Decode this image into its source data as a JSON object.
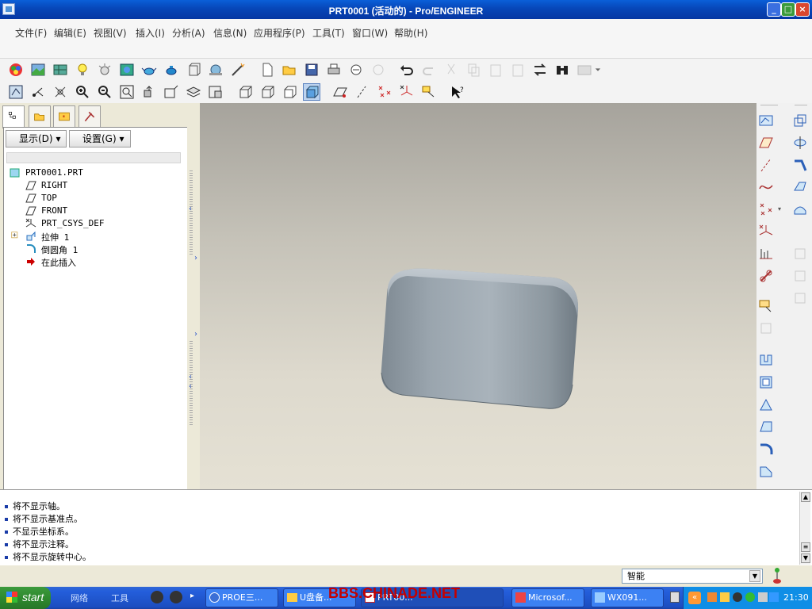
{
  "window": {
    "title": "PRT0001 (活动的) - Pro/ENGINEER"
  },
  "menu": [
    {
      "label": "文件(F)"
    },
    {
      "label": "编辑(E)"
    },
    {
      "label": "视图(V)"
    },
    {
      "label": "插入(I)"
    },
    {
      "label": "分析(A)"
    },
    {
      "label": "信息(N)"
    },
    {
      "label": "应用程序(P)"
    },
    {
      "label": "工具(T)"
    },
    {
      "label": "窗口(W)"
    },
    {
      "label": "帮助(H)"
    }
  ],
  "model_tree": {
    "show_dropdown": "显示(D)",
    "settings_dropdown": "设置(G)",
    "items": [
      {
        "label": "PRT0001.PRT",
        "icon": "part-icon"
      },
      {
        "label": "RIGHT",
        "icon": "datum-plane-icon"
      },
      {
        "label": "TOP",
        "icon": "datum-plane-icon"
      },
      {
        "label": "FRONT",
        "icon": "datum-plane-icon"
      },
      {
        "label": "PRT_CSYS_DEF",
        "icon": "csys-icon"
      },
      {
        "label": "拉伸 1",
        "icon": "extrude-icon"
      },
      {
        "label": "倒圆角 1",
        "icon": "round-icon"
      },
      {
        "label": "在此插入",
        "icon": "insert-here-arrow-icon"
      }
    ]
  },
  "messages": [
    "将不显示轴。",
    "将不显示基准点。",
    "不显示坐标系。",
    "将不显示注释。",
    "将不显示旋转中心。"
  ],
  "status": {
    "filter": "智能"
  },
  "taskbar": {
    "start": "start",
    "toolbars": [
      "网络",
      "工具"
    ],
    "tasks": [
      "PROE三...",
      "U盘备...",
      "PRT00...",
      "Microsof...",
      "WX091..."
    ],
    "clock": "21:30",
    "watermark": "BBS.CHINADE.NET"
  },
  "colors": {
    "accent": "#0a5fd8",
    "model": "#98a3ad",
    "viewport_top": "#a6a39c",
    "viewport_bottom": "#e5e1d4"
  }
}
